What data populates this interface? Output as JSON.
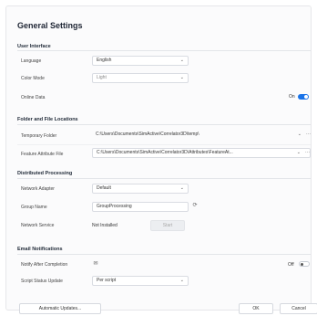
{
  "title": "General Settings",
  "sections": {
    "ui": "User Interface",
    "folders": "Folder and File Locations",
    "distributed": "Distributed Processing",
    "email": "Email Notifications"
  },
  "ui": {
    "language_label": "Language",
    "language_value": "English",
    "color_mode_label": "Color Mode",
    "color_mode_value": "Light",
    "online_data_label": "Online Data",
    "online_data_state": "On"
  },
  "folders": {
    "temp_label": "Temporary Folder",
    "temp_value": "C:\\Users\\Documents\\SimActive\\Correlator3D\\temp\\",
    "feature_label": "Feature Attribute File",
    "feature_value": "C:\\Users\\Documents\\SimActive\\Correlator3D\\Attributes\\FeatureAt..."
  },
  "distributed": {
    "adapter_label": "Network Adapter",
    "adapter_value": "Default",
    "group_label": "Group Name",
    "group_value": "GroupProcessing",
    "service_label": "Network Service",
    "service_status": "Not Installed",
    "start_label": "Start"
  },
  "email": {
    "notify_label": "Notify After Completion",
    "notify_state": "Off",
    "script_label": "Script Status Update",
    "script_value": "Per script"
  },
  "footer": {
    "updates_label": "Automatic Updates...",
    "ok_label": "OK",
    "cancel_label": "Cancel"
  },
  "icons": {
    "chevron": "chevron-down-icon",
    "more": "more-icon",
    "refresh": "refresh-icon",
    "mail": "mail-icon"
  },
  "colors": {
    "accent": "#1a73e8"
  }
}
